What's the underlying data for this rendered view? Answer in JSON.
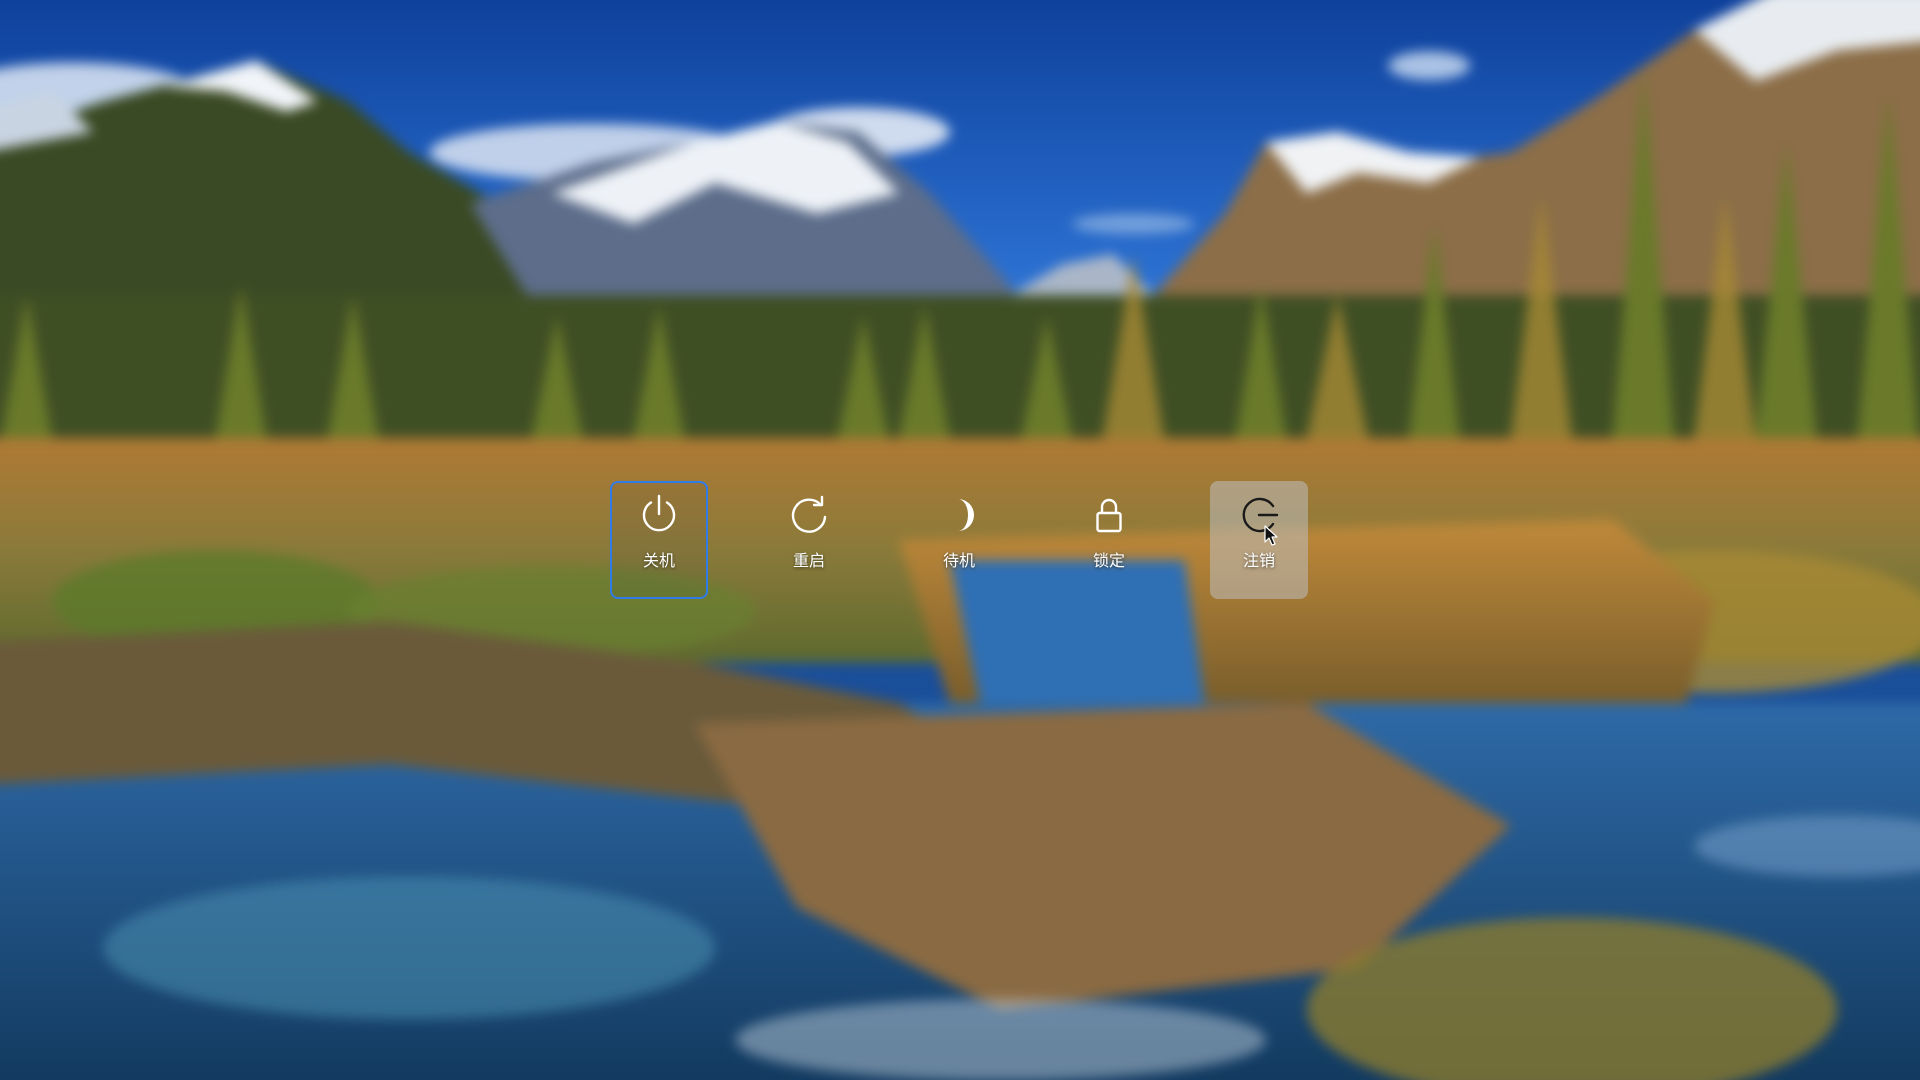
{
  "power_menu": {
    "items": [
      {
        "id": "shutdown",
        "label": "关机",
        "icon": "power-icon",
        "state": "focused"
      },
      {
        "id": "reboot",
        "label": "重启",
        "icon": "restart-icon",
        "state": "normal"
      },
      {
        "id": "suspend",
        "label": "待机",
        "icon": "moon-icon",
        "state": "normal"
      },
      {
        "id": "lock",
        "label": "锁定",
        "icon": "lock-icon",
        "state": "normal"
      },
      {
        "id": "logout",
        "label": "注销",
        "icon": "logout-icon",
        "state": "hovered"
      }
    ]
  },
  "colors": {
    "focus_border": "#2f7ce8",
    "label_text": "#ffffff",
    "hover_bg": "rgba(190,190,190,0.55)"
  }
}
